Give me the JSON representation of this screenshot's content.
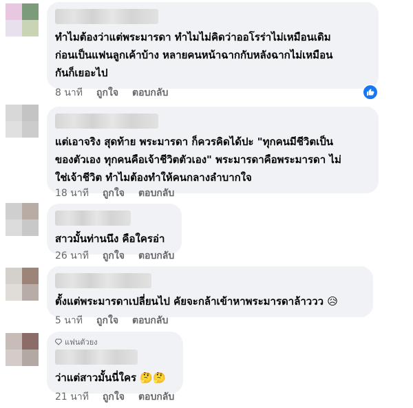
{
  "comments": [
    {
      "text": "ทำไมต้องว่าแต่พระมารดา ทำไมไม่คิดว่าออโรร่าไม่เหมือนเดิม\nก่อนเป็นแฟนลูกเค้าบ้าง หลายคนหน้าฉากกับหลังฉากไม่เหมือน\nกันก็เยอะไป",
      "time": "8 นาที",
      "like_label": "ถูกใจ",
      "reply_label": "ตอบกลับ",
      "reaction_icon": "like-icon",
      "avatar_colors": [
        "#e8c8e0",
        "#7b9b7b",
        "#e8e0ec",
        "#c8d4b4"
      ]
    },
    {
      "text": "แต่เอาจริง สุดท้าย พระมารดา ก็ควรคิดได้ปะ \"ทุกคนมีชีวิตเป็น\nของตัวเอง ทุกคนคือเจ้าชีวิตตัวเอง\" พระมารดาคือพระมารดา ไม่\nใช่เจ้าชีวิต ทำไมต้องทำให้คนกลางลำบากใจ",
      "time": "18 นาที",
      "like_label": "ถูกใจ",
      "reply_label": "ตอบกลับ",
      "avatar_colors": [
        "#d8d8d8",
        "#c4c4c4",
        "#e0e0e0",
        "#cccccc"
      ]
    },
    {
      "text": "สาวมั้นท่านนึง คือใครอ่า",
      "time": "26 นาที",
      "like_label": "ถูกใจ",
      "reply_label": "ตอบกลับ",
      "avatar_colors": [
        "#cfcfcf",
        "#b8aca4",
        "#dcdcdc",
        "#c8c8c8"
      ]
    },
    {
      "text": "ตั้งแต่พระมารดาเปลี่ยนไป คัยจะกล้าเข้าหาพระมารดาล้าววว 😥",
      "time": "5 นาที",
      "like_label": "ถูกใจ",
      "reply_label": "ตอบกลับ",
      "avatar_colors": [
        "#d4d0cc",
        "#9c8478",
        "#e0dcd8",
        "#b8aca8"
      ]
    },
    {
      "badge": "แฟนตัวยง",
      "text": "ว่าแต่สาวมั้นนี่ใคร 🤔🤔",
      "time": "21 นาที",
      "like_label": "ถูกใจ",
      "reply_label": "ตอบกลับ",
      "avatar_colors": [
        "#c8bcb8",
        "#8c6c68",
        "#d4ccc8",
        "#b4a8a4"
      ]
    }
  ]
}
